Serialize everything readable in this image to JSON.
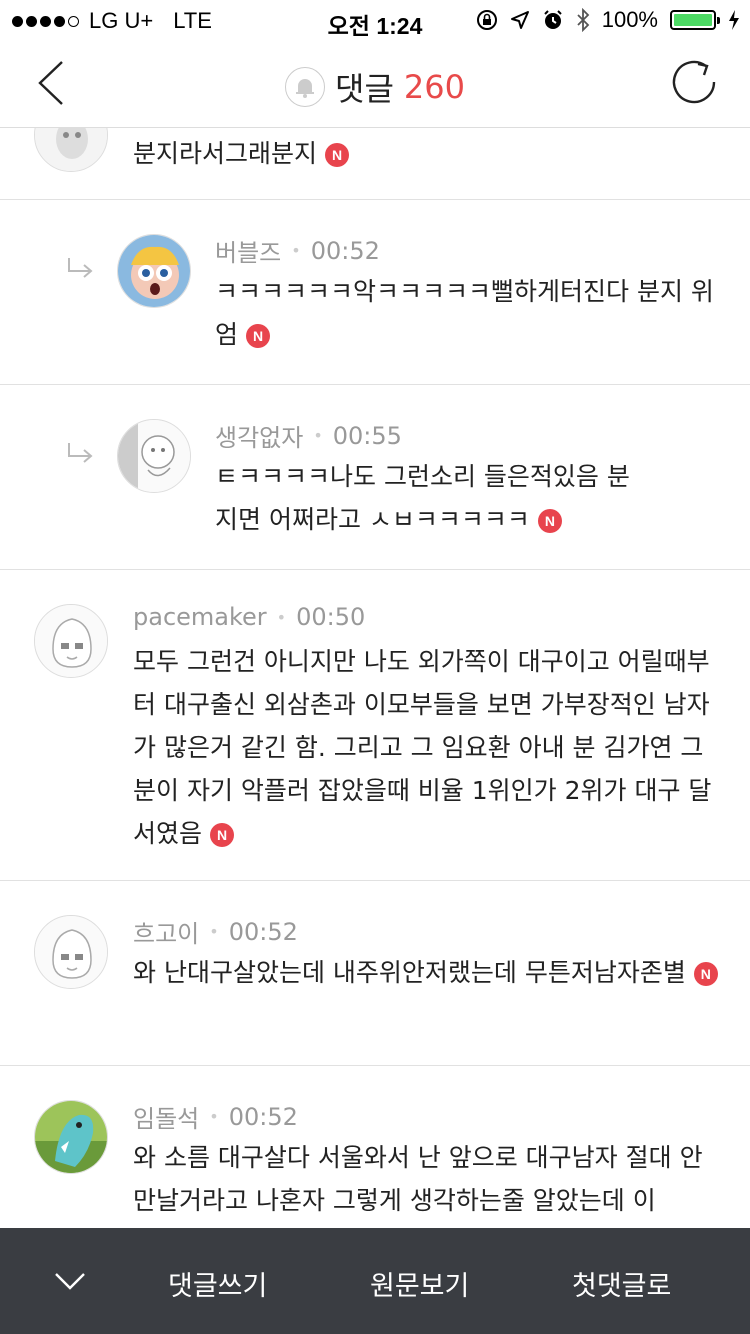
{
  "status_bar": {
    "carrier": "LG U+",
    "network": "LTE",
    "time": "오전 1:24",
    "battery": "100%"
  },
  "header": {
    "title": "댓글",
    "count": "260"
  },
  "comments": [
    {
      "author": "",
      "time": "",
      "text": "분지라서그래분지",
      "badge": "N"
    },
    {
      "author": "버블즈",
      "time": "00:52",
      "text": "ㅋㅋㅋㅋㅋㅋ악ㅋㅋㅋㅋㅋ뻘하게터진다 분지 위엄",
      "badge": "N"
    },
    {
      "author": "생각없자",
      "time": "00:55",
      "text": "ㅌㅋㅋㅋㅋ나도 그런소리 들은적있음 분지면 어쩌라고 ㅅㅂㅋㅋㅋㅋㅋ",
      "badge": "N"
    },
    {
      "author": "pacemaker",
      "time": "00:50",
      "text": "모두 그런건 아니지만 나도 외가쪽이 대구이고 어릴때부터 대구출신 외삼촌과 이모부들을 보면 가부장적인 남자가 많은거 같긴 함. 그리고  그 임요환 아내 분 김가연 그 분이 자기 악플러 잡았을때 비율 1위인가 2위가 대구 달서였음",
      "badge": "N"
    },
    {
      "author": "흐고이",
      "time": "00:52",
      "text": "와 난대구살았는데 내주위안저랬는데 무튼저남자존별",
      "badge": "N"
    },
    {
      "author": "임돌석",
      "time": "00:52",
      "text": "와 소름 대구살다 서울와서 난 앞으로 대구남자 절대 안만날거라고 나혼자 그렇게 생각하는줄 알았는데 이",
      "badge": ""
    }
  ],
  "bottom_bar": {
    "write": "댓글쓰기",
    "original": "원문보기",
    "first": "첫댓글로"
  }
}
